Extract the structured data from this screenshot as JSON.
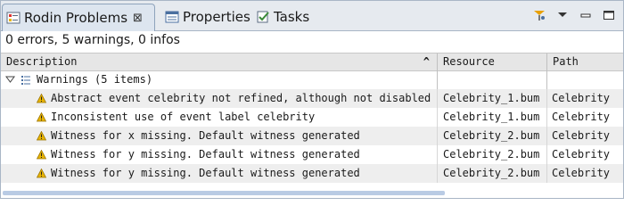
{
  "tabs": [
    {
      "label": "Rodin Problems",
      "icon": "problems-icon",
      "active": true
    },
    {
      "label": "Properties",
      "icon": "properties-icon",
      "active": false
    },
    {
      "label": "Tasks",
      "icon": "tasks-icon",
      "active": false
    }
  ],
  "close_glyph": "⊠",
  "summary": "0 errors, 5 warnings, 0 infos",
  "columns": {
    "description": "Description",
    "resource": "Resource",
    "path": "Path",
    "sort_glyph": "^"
  },
  "group": {
    "label": "Warnings (5 items)",
    "expanded": true
  },
  "rows": [
    {
      "description": "Abstract event celebrity not refined, although not disabled",
      "resource": "Celebrity_1.bum",
      "path": "Celebrity"
    },
    {
      "description": "Inconsistent use of event label celebrity",
      "resource": "Celebrity_1.bum",
      "path": "Celebrity"
    },
    {
      "description": "Witness for x missing. Default witness generated",
      "resource": "Celebrity_2.bum",
      "path": "Celebrity"
    },
    {
      "description": "Witness for y missing. Default witness generated",
      "resource": "Celebrity_2.bum",
      "path": "Celebrity"
    },
    {
      "description": "Witness for y missing. Default witness generated",
      "resource": "Celebrity_2.bum",
      "path": "Celebrity"
    }
  ],
  "colors": {
    "warning": "#e8b400",
    "tab_active": "#dde5ef",
    "border": "#a9b6c6"
  }
}
